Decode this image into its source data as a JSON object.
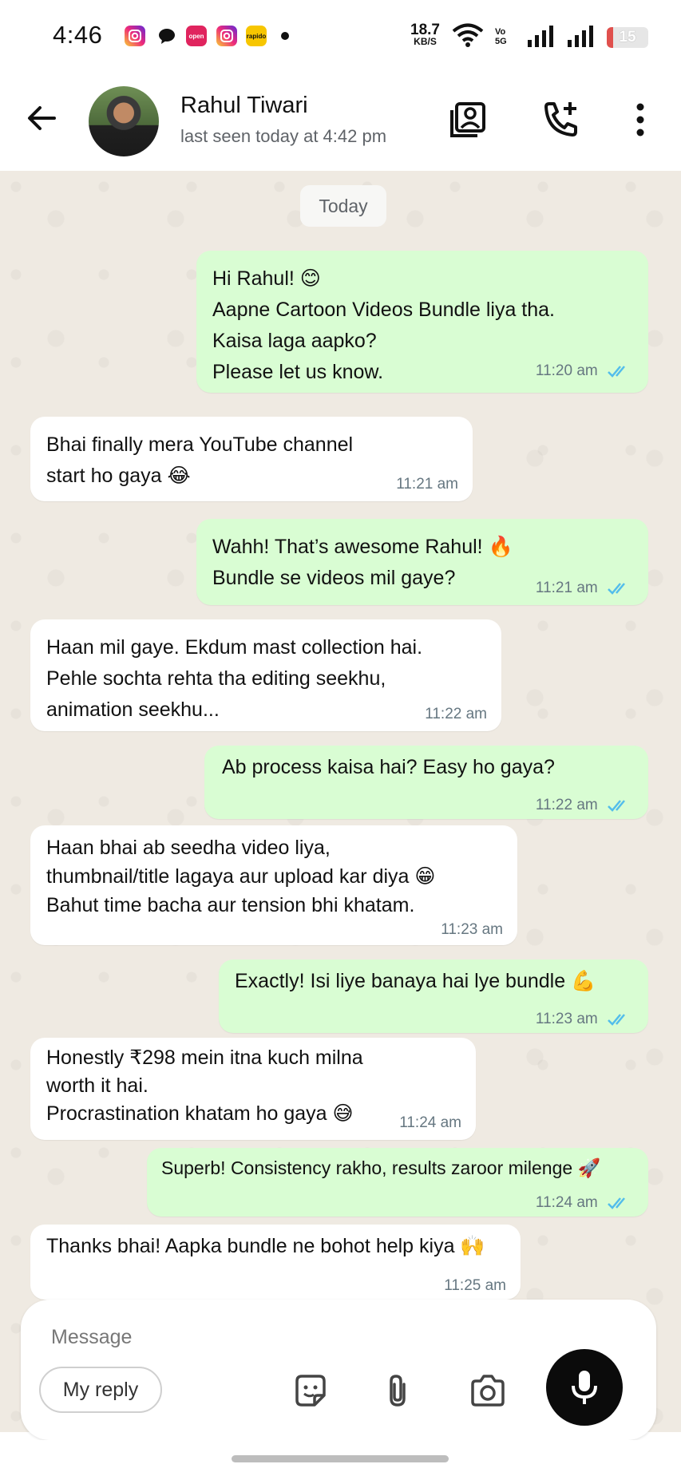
{
  "status_bar": {
    "time": "4:46",
    "notifications": [
      "instagram-icon",
      "chat-icon",
      "open-icon",
      "instagram-icon",
      "rapido-icon"
    ],
    "notif_labels": [
      "",
      "",
      "open",
      "",
      "rapido"
    ],
    "net_speed_value": "18.7",
    "net_speed_unit": "KB/S",
    "volte_label": "Vo 5G",
    "battery_level": "15"
  },
  "header": {
    "contact_name": "Rahul Tiwari",
    "last_seen": "last seen today at 4:42 pm"
  },
  "chat": {
    "date_label": "Today",
    "messages": [
      {
        "direction": "out",
        "text": "Hi Rahul! 😊\nAapne Cartoon Videos Bundle liya tha.\nKaisa laga aapko?\nPlease let us know.",
        "time": "11:20 am",
        "status": "read"
      },
      {
        "direction": "in",
        "text": "Bhai finally mera YouTube channel\nstart ho gaya 😂",
        "time": "11:21 am"
      },
      {
        "direction": "out",
        "text": "Wahh! That’s awesome Rahul! 🔥\nBundle se videos mil gaye?",
        "time": "11:21 am",
        "status": "read"
      },
      {
        "direction": "in",
        "text": "Haan mil gaye. Ekdum mast collection hai.\nPehle sochta rehta tha editing seekhu,\nanimation seekhu...",
        "time": "11:22 am"
      },
      {
        "direction": "out",
        "text": "Ab process kaisa hai? Easy ho gaya?",
        "time": "11:22 am",
        "status": "read"
      },
      {
        "direction": "in",
        "text": "Haan bhai ab seedha video liya,\nthumbnail/title lagaya aur upload kar diya 😁\nBahut time bacha aur tension bhi khatam.",
        "time": "11:23 am"
      },
      {
        "direction": "out",
        "text": "Exactly! Isi liye banaya hai lye bundle 💪",
        "time": "11:23 am",
        "status": "read"
      },
      {
        "direction": "in",
        "text": "Honestly ₹298 mein itna kuch milna\nworth it hai.\nProcrastination khatam ho gaya 😅",
        "time": "11:24 am"
      },
      {
        "direction": "out",
        "text": "Superb! Consistency rakho, results zaroor milenge 🚀",
        "time": "11:24 am",
        "status": "read"
      },
      {
        "direction": "in",
        "text": "Thanks bhai! Aapka bundle ne bohot help kiya 🙌",
        "time": "11:25 am"
      }
    ]
  },
  "composer": {
    "placeholder": "Message",
    "reply_chip": "My reply"
  },
  "colors": {
    "outgoing_bubble": "#d9fdd3",
    "incoming_bubble": "#ffffff",
    "chat_background": "#efeae2",
    "read_tick": "#53bdeb",
    "mic_button": "#0b0b0b"
  }
}
